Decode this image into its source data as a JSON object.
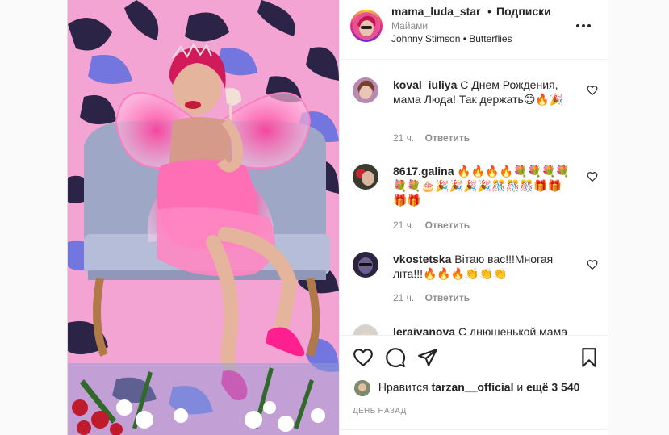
{
  "post": {
    "username": "mama_luda_star",
    "separator": "•",
    "follow_label": "Подписки",
    "location": "Майами",
    "audio": "Johnny Stimson • Butterflies",
    "more_icon": "more-horizontal-icon"
  },
  "comments": [
    {
      "user": "koval_iuliya",
      "text": "С Днем Рождения, мама Люда! Так держать😊🔥🎉",
      "time": "21 ч.",
      "reply_label": "Ответить"
    },
    {
      "user": "8617.galina",
      "text": "🔥🔥🔥🔥💐💐💐💐💐💐🎂🎉🎉🎉🎉🎊🎊🎊🎁🎁🎁🎁",
      "time": "21 ч.",
      "reply_label": "Ответить"
    },
    {
      "user": "vkostetska",
      "text": "Вітаю вас!!!Многая літа!!!🔥🔥🔥👏👏👏",
      "time": "21 ч.",
      "reply_label": "Ответить"
    },
    {
      "user": "lerajvanova",
      "text": "С днюшенькой мама",
      "time": "",
      "reply_label": ""
    }
  ],
  "actions": {
    "like_icon": "heart-icon",
    "comment_icon": "comment-icon",
    "share_icon": "paper-plane-icon",
    "save_icon": "bookmark-icon"
  },
  "likes": {
    "prefix": "Нравится",
    "user": "tarzan__official",
    "middle": "и",
    "count": "ещё 3 540"
  },
  "date": "ДЕНЬ НАЗАД",
  "colors": {
    "text": "#262626",
    "secondary": "#8e8e8e",
    "border": "#efefef"
  }
}
